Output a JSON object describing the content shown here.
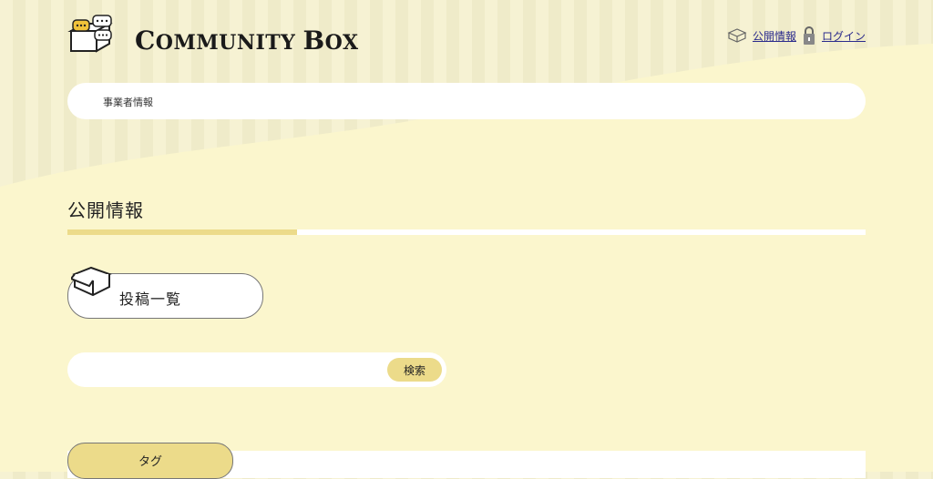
{
  "header": {
    "logo_text_big_c": "C",
    "logo_text_rest1": "OMMUNITY ",
    "logo_text_big_b": "B",
    "logo_text_rest2": "OX",
    "links": {
      "public_info": "公開情報",
      "login": "ログイン"
    }
  },
  "breadcrumb": {
    "label": "事業者情報"
  },
  "main": {
    "section_title": "公開情報",
    "post_list_label": "投稿一覧",
    "search": {
      "value": "",
      "placeholder": "",
      "button_label": "検索"
    },
    "tag_label": "タグ"
  },
  "colors": {
    "accent": "#ecdb8a",
    "background_cream": "#fbf6cd",
    "link": "#2b2b8c"
  },
  "icons": [
    "community-box-logo-icon",
    "box-icon",
    "lock-icon",
    "open-box-icon"
  ]
}
